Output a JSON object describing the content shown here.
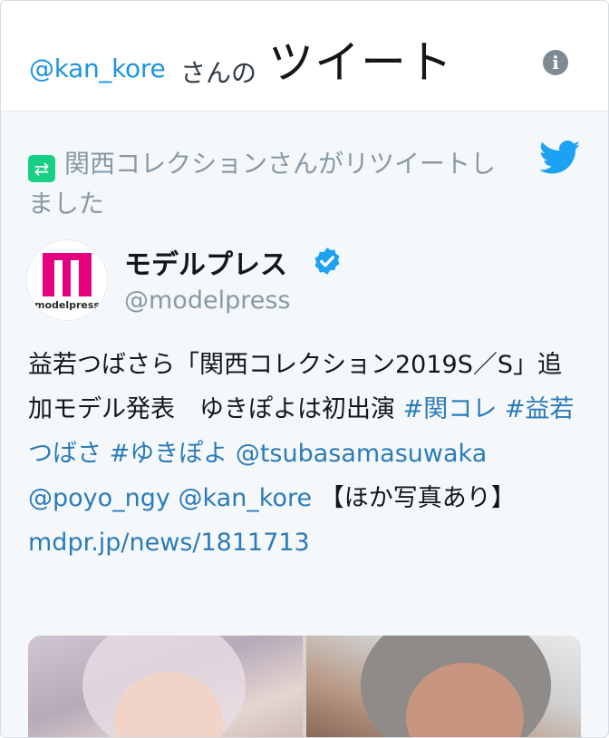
{
  "header": {
    "handle": "@kan_kore",
    "suffix": "さんの",
    "title": "ツイート",
    "info_icon": "info-icon"
  },
  "retweet": {
    "text": "関西コレクションさんがリツイートしました",
    "icon": "retweet-icon"
  },
  "brand": {
    "icon": "twitter-bird-icon",
    "color": "#1da1f2"
  },
  "author": {
    "name": "モデルプレス",
    "handle": "@modelpress",
    "verified": true,
    "avatar_text": "modelpress"
  },
  "tweet": {
    "text_1": "益若つばさら「関西コレクション2019S／S」追加モデル発表　ゆきぽよは初出演 ",
    "hashtag_1": "#関コレ",
    "hashtag_2": "#益若つばさ",
    "hashtag_3": "#ゆきぽよ",
    "mention_1": "@tsubasamasuwaka",
    "mention_2": "@poyo_ngy",
    "mention_3": "@kan_kore",
    "text_2": " 【ほか写真あり】",
    "link": "mdpr.jp/news/1811713"
  },
  "colors": {
    "link": "#2b7bb9",
    "handle_blue": "#1b95e0",
    "retweet_green": "#19cf86",
    "muted": "#8899a6"
  }
}
